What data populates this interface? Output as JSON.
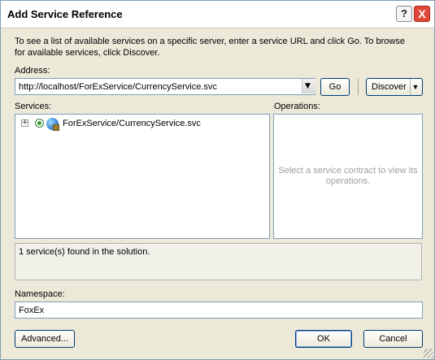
{
  "window": {
    "title": "Add Service Reference",
    "help_button": "?",
    "close_button": "X"
  },
  "intro_text": "To see a list of available services on a specific server, enter a service URL and click Go. To browse for available services, click Discover.",
  "address": {
    "label": "Address:",
    "value": "http://localhost/ForExService/CurrencyService.svc",
    "go_button": "Go",
    "discover_button": "Discover"
  },
  "services": {
    "label": "Services:",
    "items": [
      {
        "label": "ForExService/CurrencyService.svc",
        "expanded": false,
        "icon": "service-globe-icon"
      }
    ]
  },
  "operations": {
    "label": "Operations:",
    "placeholder": "Select a service contract to view its operations."
  },
  "status": {
    "message": "1 service(s) found in the solution."
  },
  "namespace": {
    "label": "Namespace:",
    "value": "FoxEx"
  },
  "buttons": {
    "advanced": "Advanced...",
    "ok": "OK",
    "cancel": "Cancel"
  },
  "colors": {
    "dialog_background": "#ece9d8",
    "border_blue": "#7f9db9",
    "close_red": "#e0483a"
  }
}
